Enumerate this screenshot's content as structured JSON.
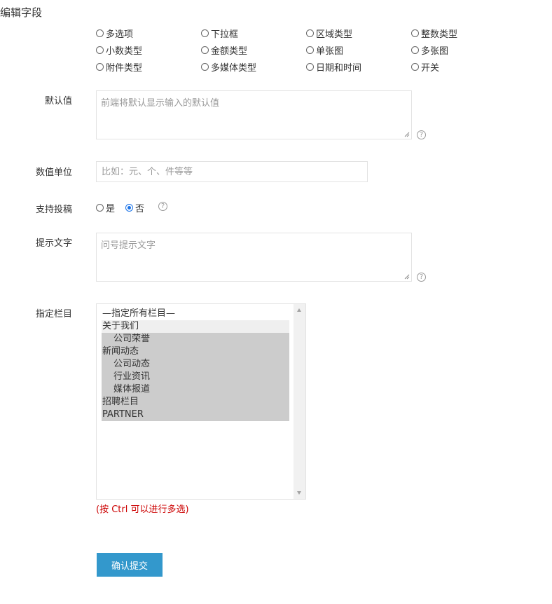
{
  "page_title": "编辑字段",
  "field_types": [
    [
      "多选项",
      "下拉框",
      "区域类型",
      "整数类型"
    ],
    [
      "小数类型",
      "金额类型",
      "单张图",
      "多张图"
    ],
    [
      "附件类型",
      "多媒体类型",
      "日期和时间",
      "开关"
    ]
  ],
  "default_value": {
    "label": "默认值",
    "placeholder": "前端将默认显示输入的默认值"
  },
  "unit": {
    "label": "数值单位",
    "placeholder": "比如：元、个、件等等"
  },
  "submission": {
    "label": "支持投稿",
    "yes": "是",
    "no": "否",
    "selected": "否"
  },
  "hint_text": {
    "label": "提示文字",
    "placeholder": "问号提示文字"
  },
  "columns": {
    "label": "指定栏目",
    "options": [
      "—指定所有栏目—",
      "关于我们",
      "公司荣誉",
      "新闻动态",
      "公司动态",
      "行业资讯",
      "媒体报道",
      "招聘栏目",
      "PARTNER"
    ],
    "multi_hint": "(按 Ctrl 可以进行多选)"
  },
  "help_glyph": "?",
  "submit_label": "确认提交",
  "colors": {
    "accent": "#3398cc",
    "hint_red": "#cc0000",
    "selected_bg": "#cccccc",
    "radio_checked": "#1a73e8"
  }
}
